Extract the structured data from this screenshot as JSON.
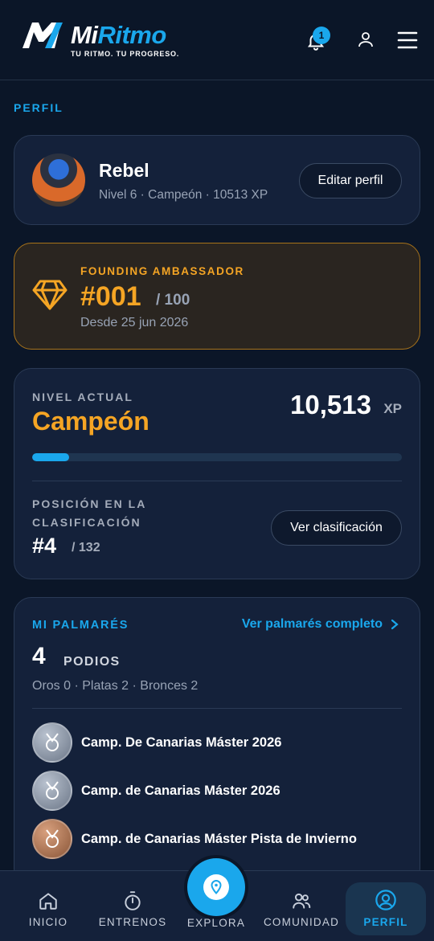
{
  "header": {
    "brand_mi": "Mi",
    "brand_ritmo": "Ritmo",
    "tagline": "TU RITMO. TU PROGRESO.",
    "notification_count": "1",
    "icons": [
      "logo-icon",
      "bell-icon",
      "user-icon",
      "menu-icon"
    ],
    "accent_color": "#1aa7ec"
  },
  "page": {
    "section_label": "PERFIL"
  },
  "profile": {
    "name": "Rebel",
    "subtitle": "Nivel 6 · Campeón · 10513 XP",
    "edit_button": "Editar perfil"
  },
  "ambassador": {
    "label": "FOUNDING AMBASSADOR",
    "number": "#001",
    "total": "/ 100",
    "since": "Desde 25 jun 2026",
    "accent_color": "#f5a524",
    "icon": "diamond-icon"
  },
  "level": {
    "label": "NIVEL ACTUAL",
    "name": "Campeón",
    "xp": "10,513",
    "xp_unit": "XP",
    "progress_fraction": 0.1,
    "rank_label": "POSICIÓN EN LA CLASIFICACIÓN",
    "rank": "#4",
    "rank_total": "/ 132",
    "rank_button": "Ver clasificación"
  },
  "palmares": {
    "label": "MI PALMARÉS",
    "link": "Ver palmarés completo",
    "count": "4",
    "count_label": "PODIOS",
    "breakdown": "Oros 0 · Platas 2 · Bronces 2",
    "items": [
      {
        "title": "Camp. De Canarias Máster 2026",
        "medal": "silver"
      },
      {
        "title": "Camp. de Canarias Máster 2026",
        "medal": "silver"
      },
      {
        "title": "Camp. de Canarias Máster Pista de Invierno",
        "medal": "bronze"
      }
    ]
  },
  "nav": {
    "items": [
      {
        "label": "INICIO",
        "icon": "home-icon"
      },
      {
        "label": "ENTRENOS",
        "icon": "stopwatch-icon"
      },
      {
        "label": "EXPLORA",
        "icon": "location-pin-icon"
      },
      {
        "label": "COMUNIDAD",
        "icon": "users-icon"
      },
      {
        "label": "PERFIL",
        "icon": "profile-icon"
      }
    ],
    "active": "PERFIL"
  }
}
